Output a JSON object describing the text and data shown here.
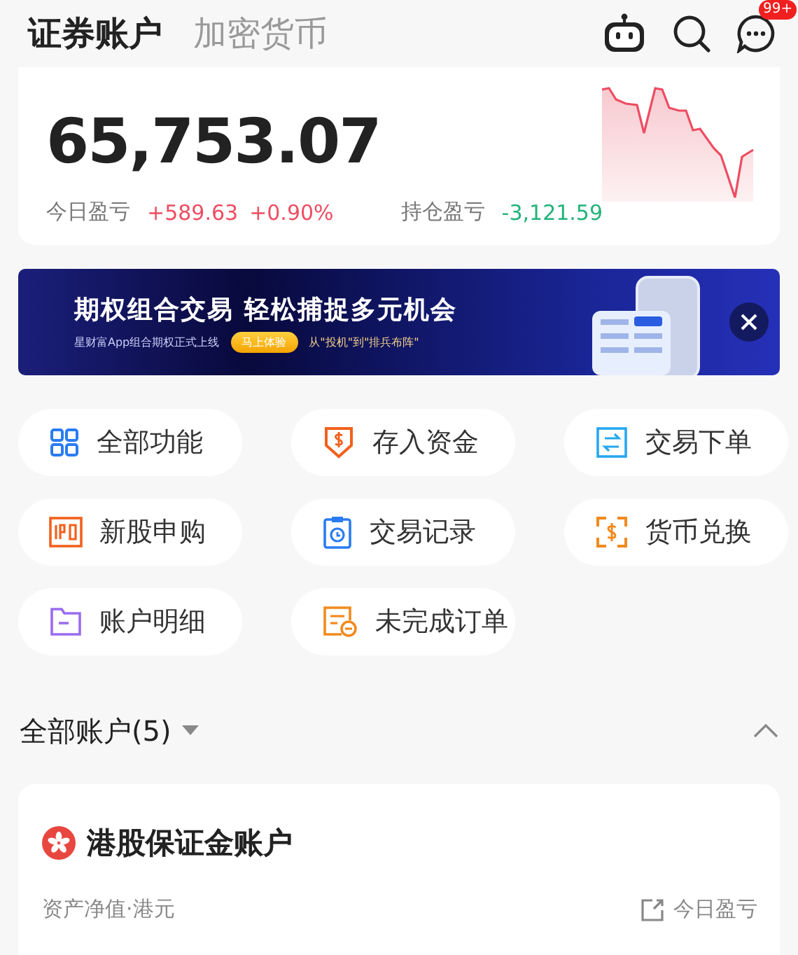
{
  "tabs": [
    {
      "label": "证券账户",
      "selected": true
    },
    {
      "label": "加密货币",
      "selected": false
    }
  ],
  "header": {
    "badge": "99+"
  },
  "summary": {
    "total": "65,753.07",
    "today_label": "今日盈亏",
    "today_value": "+589.63",
    "today_pct": "+0.90%",
    "holding_label": "持仓盈亏",
    "holding_value": "-3,121.59"
  },
  "banner": {
    "title": "期权组合交易 轻松捕捉多元机会",
    "subtitle": "星财富App组合期权正式上线",
    "button": "马上体验",
    "tagline": "从\"投机\"到\"排兵布阵\""
  },
  "actions": [
    {
      "label": "全部功能"
    },
    {
      "label": "存入资金"
    },
    {
      "label": "交易下单"
    },
    {
      "label": "新股申购"
    },
    {
      "label": "交易记录"
    },
    {
      "label": "货币兑换"
    },
    {
      "label": "账户明细"
    },
    {
      "label": "未完成订单"
    }
  ],
  "accounts": {
    "title": "全部账户(5)",
    "expanded": true
  },
  "account_card": {
    "name": "港股保证金账户",
    "asset_label": "资产净值·港元",
    "pnl_label": "今日盈亏"
  }
}
